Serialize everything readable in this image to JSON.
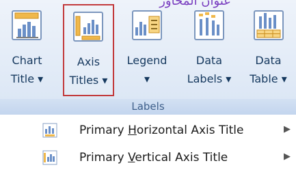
{
  "banner": {
    "text": "عنوان المحاور"
  },
  "ribbon": {
    "buttons": [
      {
        "line1": "Chart",
        "line2": "Title ▾",
        "selected": false,
        "icon": "chart-title-icon"
      },
      {
        "line1": "Axis",
        "line2": "Titles ▾",
        "selected": true,
        "icon": "axis-titles-icon"
      },
      {
        "line1": "Legend",
        "line2": "▾",
        "selected": false,
        "icon": "legend-icon"
      },
      {
        "line1": "Data",
        "line2": "Labels ▾",
        "selected": false,
        "icon": "data-labels-icon"
      },
      {
        "line1": "Data",
        "line2": "Table ▾",
        "selected": false,
        "icon": "data-table-icon"
      }
    ],
    "group_label": "Labels"
  },
  "menu": {
    "items": [
      {
        "before": "Primary ",
        "accel": "H",
        "after": "orizontal Axis Title",
        "icon": "horizontal-axis-title-icon",
        "has_submenu": true,
        "arrow": "▶"
      },
      {
        "before": "Primary ",
        "accel": "V",
        "after": "ertical Axis Title",
        "icon": "vertical-axis-title-icon",
        "has_submenu": true,
        "arrow": "▶"
      }
    ]
  },
  "colors": {
    "selected_border": "#c2393b",
    "label_text": "#15385e",
    "banner_text": "#7a3fc0"
  }
}
